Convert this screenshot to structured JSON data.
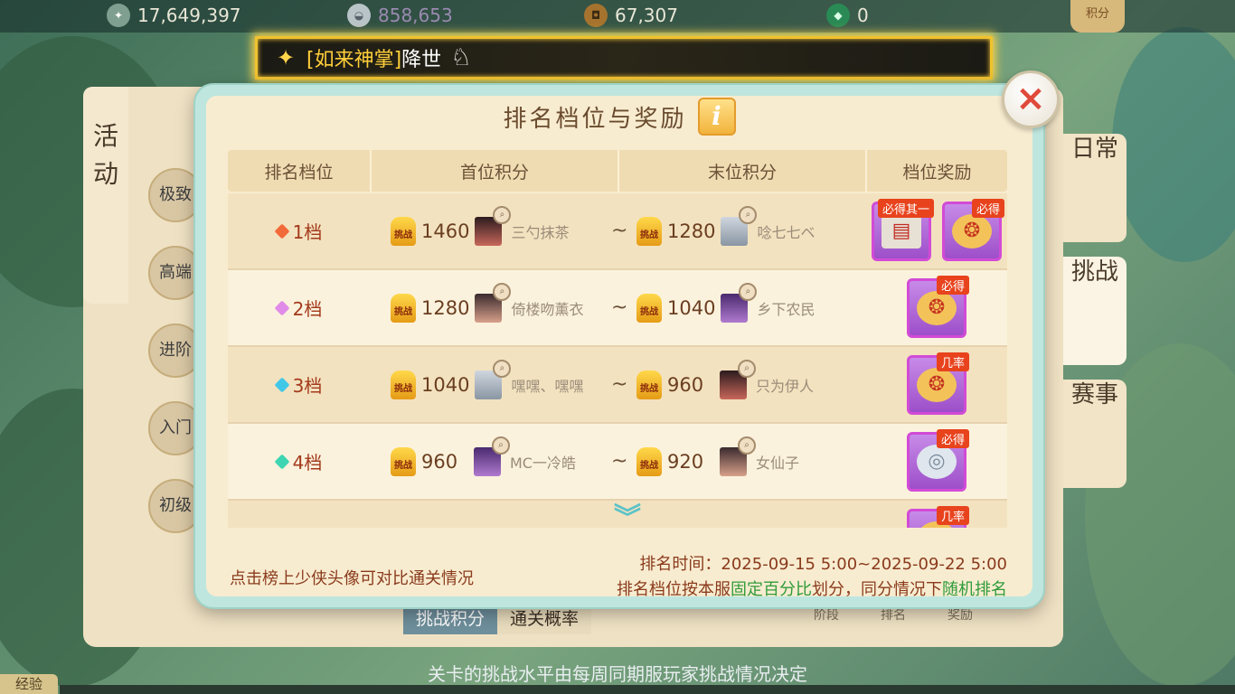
{
  "currency": [
    {
      "icon": "jade-coin-icon",
      "value": "17,649,397",
      "dim": false
    },
    {
      "icon": "silver-ingot-icon",
      "value": "858,653",
      "dim": true
    },
    {
      "icon": "copper-coin-icon",
      "value": "67,307",
      "dim": false
    },
    {
      "icon": "green-gem-icon",
      "value": "0",
      "dim": false
    }
  ],
  "score_badge": "积分",
  "banner": {
    "item": "[如来神掌]",
    "text": "降世"
  },
  "background": {
    "left_tab": "活动",
    "categories": [
      "极致",
      "高端",
      "进阶",
      "入门",
      "初级"
    ],
    "right_tabs": [
      "日常",
      "挑战",
      "赛事"
    ],
    "bottom_tabs": [
      "挑战积分",
      "通关概率"
    ],
    "minis": [
      "阶段",
      "排名",
      "奖励"
    ],
    "footer_note": "关卡的挑战水平由每周同期服玩家挑战情况决定",
    "exp_label": "经验"
  },
  "dialog": {
    "title": "排名档位与奖励",
    "info_icon": "i",
    "close_icon": "×",
    "headers": [
      "排名档位",
      "首位积分",
      "末位积分",
      "档位奖励"
    ],
    "rows": [
      {
        "tier": "1档",
        "gem_color": "#f26a3a",
        "first_score": "1460",
        "first_name": "三勺抹茶",
        "last_score": "1280",
        "last_name": "唸七七ベ",
        "rewards": [
          {
            "tag": "必得其一",
            "kind": "book"
          },
          {
            "tag": "必得",
            "kind": "pouch"
          }
        ]
      },
      {
        "tier": "2档",
        "gem_color": "#e08be8",
        "first_score": "1280",
        "first_name": "倚楼吻薰衣",
        "last_score": "1040",
        "last_name": "乡下农民",
        "rewards": [
          {
            "tag": "必得",
            "kind": "pouch"
          }
        ]
      },
      {
        "tier": "3档",
        "gem_color": "#41c7e8",
        "first_score": "1040",
        "first_name": "嘿嘿、嘿嘿",
        "last_score": "960",
        "last_name": "只为伊人",
        "rewards": [
          {
            "tag": "几率",
            "kind": "pouch"
          }
        ]
      },
      {
        "tier": "4档",
        "gem_color": "#3ed5b2",
        "first_score": "960",
        "first_name": "MC一冷皓",
        "last_score": "920",
        "last_name": "女仙子",
        "rewards": [
          {
            "tag": "必得",
            "kind": "silver"
          }
        ]
      },
      {
        "tier": "",
        "gem_color": "#3ed5b2",
        "first_score": "",
        "first_name": "",
        "last_score": "",
        "last_name": "",
        "rewards": [
          {
            "tag": "几率",
            "kind": "pouch"
          }
        ]
      }
    ],
    "bag_label": "挑战",
    "tilde": "~",
    "hint": "点击榜上少侠头像可对比通关情况",
    "time_text": "排名时间：2025-09-15 5:00~2025-09-22 5:00",
    "rule": {
      "a": "排名档位按本服",
      "b": "固定百分比",
      "c": "划分，同分情况下",
      "d": "随机排名"
    }
  }
}
